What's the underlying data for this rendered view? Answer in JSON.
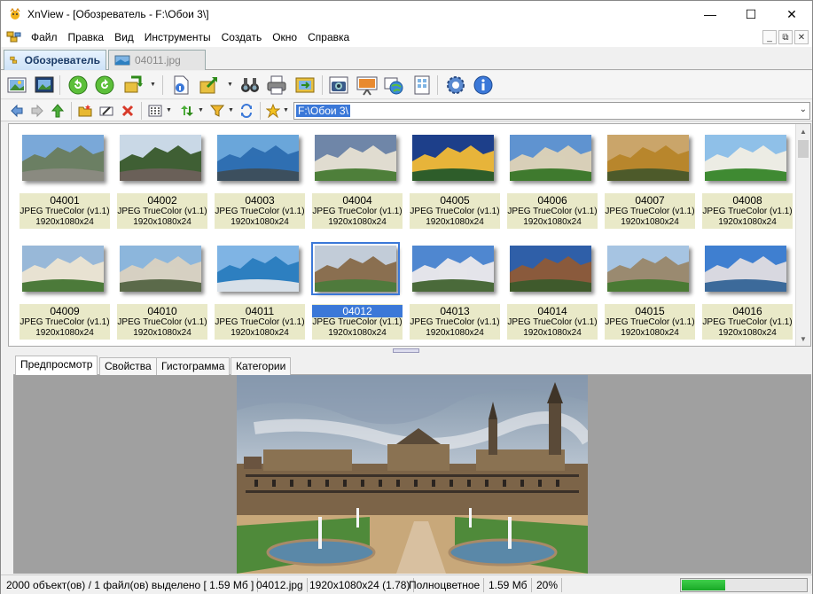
{
  "window": {
    "title": "XnView - [Обозреватель - F:\\Обои 3\\]"
  },
  "window_controls": {
    "minimize": "—",
    "maximize": "☐",
    "close": "✕"
  },
  "menu": {
    "items": [
      "Файл",
      "Правка",
      "Вид",
      "Инструменты",
      "Создать",
      "Окно",
      "Справка"
    ]
  },
  "mdi_controls": {
    "minimize": "_",
    "restore": "⧉",
    "close": "✕"
  },
  "doc_tabs": [
    {
      "label": "Обозреватель",
      "active": true
    },
    {
      "label": "04011.jpg",
      "active": false
    }
  ],
  "address": {
    "path": "F:\\Обои 3\\"
  },
  "thumbnails": [
    {
      "name": "04001",
      "format": "JPEG TrueColor (v1.1)",
      "dims": "1920x1080x24",
      "palette": [
        "#7aa8d8",
        "#6b7f63",
        "#8a8a80"
      ]
    },
    {
      "name": "04002",
      "format": "JPEG TrueColor (v1.1)",
      "dims": "1920x1080x24",
      "palette": [
        "#c9d8e6",
        "#3f5f34",
        "#6a6058"
      ]
    },
    {
      "name": "04003",
      "format": "JPEG TrueColor (v1.1)",
      "dims": "1920x1080x24",
      "palette": [
        "#6aa6da",
        "#2f6fb2",
        "#3c4f5e"
      ]
    },
    {
      "name": "04004",
      "format": "JPEG TrueColor (v1.1)",
      "dims": "1920x1080x24",
      "palette": [
        "#6f86a8",
        "#e0dcd0",
        "#4e7f3a"
      ]
    },
    {
      "name": "04005",
      "format": "JPEG TrueColor (v1.1)",
      "dims": "1920x1080x24",
      "palette": [
        "#1d3f8a",
        "#e7b43a",
        "#2e5d2a"
      ]
    },
    {
      "name": "04006",
      "format": "JPEG TrueColor (v1.1)",
      "dims": "1920x1080x24",
      "palette": [
        "#5f93d0",
        "#d8cfb8",
        "#3f7a2e"
      ]
    },
    {
      "name": "04007",
      "format": "JPEG TrueColor (v1.1)",
      "dims": "1920x1080x24",
      "palette": [
        "#caa56a",
        "#b8862c",
        "#4d5a2a"
      ]
    },
    {
      "name": "04008",
      "format": "JPEG TrueColor (v1.1)",
      "dims": "1920x1080x24",
      "palette": [
        "#8fc0e8",
        "#ecece4",
        "#3f8a32"
      ]
    },
    {
      "name": "04009",
      "format": "JPEG TrueColor (v1.1)",
      "dims": "1920x1080x24",
      "palette": [
        "#98b8d8",
        "#e8e2d2",
        "#4c7a3a"
      ]
    },
    {
      "name": "04010",
      "format": "JPEG TrueColor (v1.1)",
      "dims": "1920x1080x24",
      "palette": [
        "#8cb6dc",
        "#d6d0c2",
        "#5b6a4a"
      ]
    },
    {
      "name": "04011",
      "format": "JPEG TrueColor (v1.1)",
      "dims": "1920x1080x24",
      "palette": [
        "#7fb4e4",
        "#2d7fc0",
        "#d8e0e8"
      ]
    },
    {
      "name": "04012",
      "format": "JPEG TrueColor (v1.1)",
      "dims": "1920x1080x24",
      "palette": [
        "#c2ccd8",
        "#8a6f50",
        "#4f7a3c"
      ],
      "selected": true
    },
    {
      "name": "04013",
      "format": "JPEG TrueColor (v1.1)",
      "dims": "1920x1080x24",
      "palette": [
        "#4f87d0",
        "#e4e4ea",
        "#4a6a3a"
      ]
    },
    {
      "name": "04014",
      "format": "JPEG TrueColor (v1.1)",
      "dims": "1920x1080x24",
      "palette": [
        "#2f5fa8",
        "#8a5a3c",
        "#3f5a2c"
      ]
    },
    {
      "name": "04015",
      "format": "JPEG TrueColor (v1.1)",
      "dims": "1920x1080x24",
      "palette": [
        "#a6c4e2",
        "#9a8a70",
        "#4a7a34"
      ]
    },
    {
      "name": "04016",
      "format": "JPEG TrueColor (v1.1)",
      "dims": "1920x1080x24",
      "palette": [
        "#3f7fd0",
        "#d8d8e0",
        "#3c6a9a"
      ]
    }
  ],
  "preview_tabs": [
    {
      "label": "Предпросмотр",
      "active": true
    },
    {
      "label": "Свойства",
      "active": false
    },
    {
      "label": "Гистограмма",
      "active": false
    },
    {
      "label": "Категории",
      "active": false
    }
  ],
  "status": {
    "objects": "2000 объект(ов) / 1 файл(ов) выделено  [ 1.59 Мб ]",
    "filename": "04012.jpg",
    "dimensions": "1920x1080x24 (1.78)",
    "color_mode": "Полноцветное",
    "size": "1.59 Мб",
    "zoom": "20%",
    "progress": 0.35
  },
  "colors": {
    "accent": "#3b78d8",
    "label_bg": "#e9e9c8",
    "progress": "#22b02e"
  }
}
